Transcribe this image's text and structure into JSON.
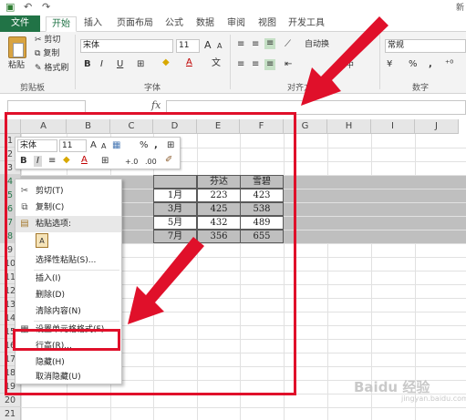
{
  "qat": {
    "save_icon": "save-icon",
    "undo_icon": "undo-icon",
    "redo_icon": "redo-icon",
    "right_text": "新"
  },
  "tabs": [
    {
      "label": "文件"
    },
    {
      "label": "开始"
    },
    {
      "label": "插入"
    },
    {
      "label": "页面布局"
    },
    {
      "label": "公式"
    },
    {
      "label": "数据"
    },
    {
      "label": "审阅"
    },
    {
      "label": "视图"
    },
    {
      "label": "开发工具"
    }
  ],
  "ribbon": {
    "paste": "粘贴",
    "cut": "剪切",
    "copy": "复制",
    "format_painter": "格式刷",
    "clipboard_label": "剪贴板",
    "font_name": "宋体",
    "font_size": "11",
    "grow": "A",
    "shrink": "A",
    "bold": "B",
    "italic": "I",
    "underline": "U",
    "font_color_glyph": "A",
    "font_label": "字体",
    "wrap": "自动换",
    "merge": "居中",
    "align_label": "对齐方",
    "number_format": "常规",
    "currency": "¥",
    "percent": "%",
    "comma": ",",
    "number_label": "数字"
  },
  "columns": [
    "A",
    "B",
    "C",
    "D",
    "E",
    "F",
    "G",
    "H",
    "I",
    "J"
  ],
  "rows": [
    "1",
    "2",
    "3",
    "4",
    "5",
    "6",
    "7",
    "8",
    "9",
    "10",
    "11",
    "12",
    "13",
    "14",
    "15",
    "16",
    "17",
    "18",
    "19",
    "20",
    "21"
  ],
  "table": {
    "headers": [
      "芬达",
      "雪碧"
    ],
    "rows": [
      {
        "month": "1月",
        "a": "223",
        "b": "423"
      },
      {
        "month": "3月",
        "a": "425",
        "b": "538"
      },
      {
        "month": "5月",
        "a": "432",
        "b": "489"
      },
      {
        "month": "7月",
        "a": "356",
        "b": "655"
      }
    ]
  },
  "mini_toolbar": {
    "font_name": "宋体",
    "font_size": "11",
    "percent": "%",
    "comma": ",",
    "bold": "B",
    "italic": "I",
    "font_color_glyph": "A",
    "inc_decimal": "+.0",
    "dec_decimal": ".00"
  },
  "context_menu": {
    "cut": "剪切(T)",
    "copy": "复制(C)",
    "paste_options": "粘贴选项:",
    "paste_option_glyph": "A",
    "paste_special": "选择性粘贴(S)...",
    "insert": "插入(I)",
    "delete": "删除(D)",
    "clear": "清除内容(N)",
    "format_cells": "设置单元格格式(F)...",
    "row_height": "行高(R)...",
    "hide": "隐藏(H)",
    "unhide": "取消隐藏(U)"
  },
  "watermark": {
    "main": "Baidu 经验",
    "sub": "jingyan.baidu.com"
  },
  "colors": {
    "excel_green": "#217346",
    "annotation_red": "#e0102a",
    "selection_gray": "#bfbfbf"
  }
}
